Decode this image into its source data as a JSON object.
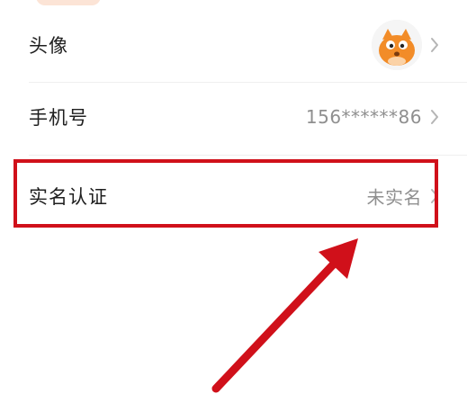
{
  "profile_rows": {
    "avatar": {
      "label": "头像",
      "icon": "chevron-right-icon"
    },
    "phone": {
      "label": "手机号",
      "value": "156******86",
      "icon": "chevron-right-icon"
    },
    "real_name": {
      "label": "实名认证",
      "value": "未实名",
      "icon": "chevron-right-icon"
    }
  },
  "colors": {
    "annotation": "#d0101a",
    "avatar_orange": "#f28c28",
    "value_gray": "#8f8f8f"
  }
}
